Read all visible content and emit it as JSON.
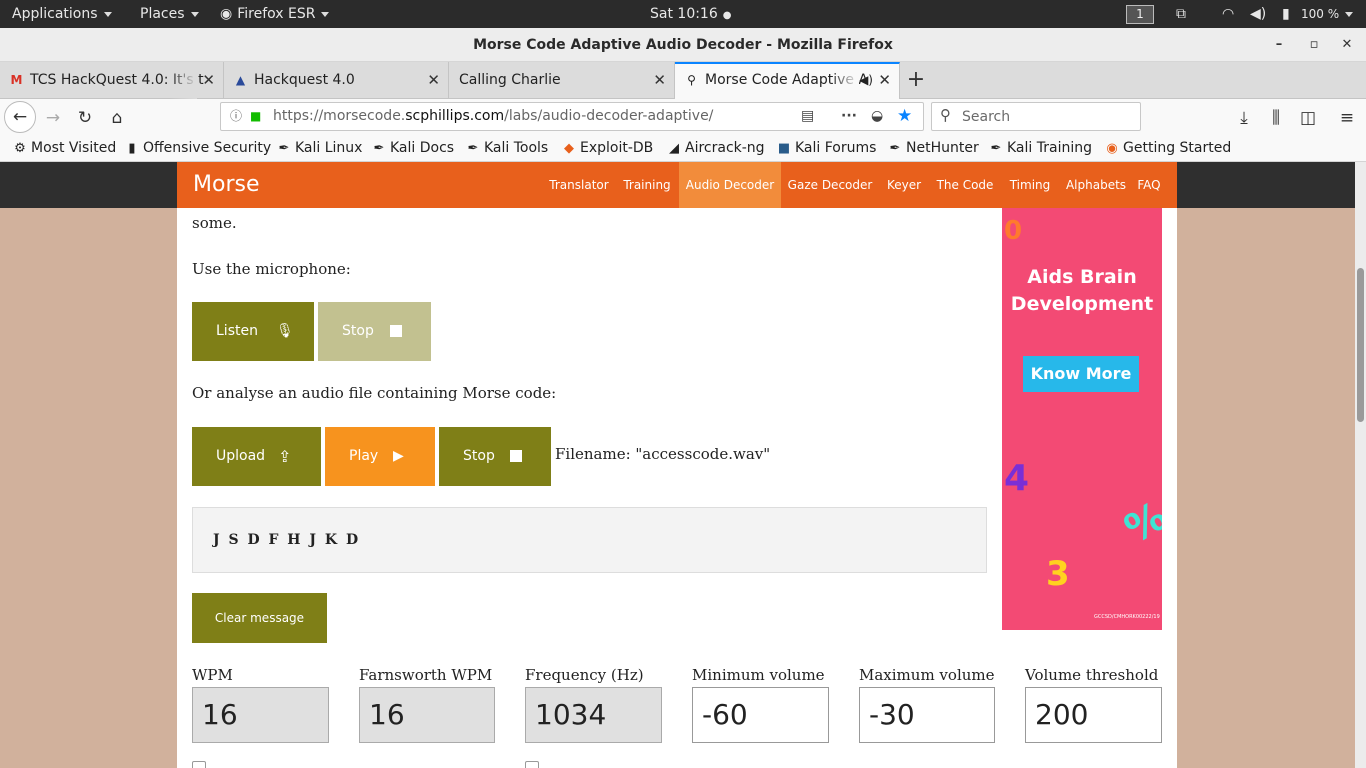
{
  "topbar": {
    "applications": "Applications",
    "places": "Places",
    "firefox": "Firefox ESR",
    "clock": "Sat 10:16",
    "workspace": "1",
    "battery": "100 %"
  },
  "window": {
    "title": "Morse Code Adaptive Audio Decoder - Mozilla Firefox"
  },
  "tabs": [
    {
      "label": "TCS HackQuest 4.0: It's t",
      "icon": "gmail-icon"
    },
    {
      "label": "Hackquest 4.0",
      "icon": "tata-icon"
    },
    {
      "label": "Calling Charlie",
      "icon": ""
    },
    {
      "label": "Morse Code Adaptive A",
      "icon": "morse-icon",
      "active": true
    }
  ],
  "navbar": {
    "url_prefix": "https://morsecode.",
    "url_domain": "scphillips.com",
    "url_path": "/labs/audio-decoder-adaptive/",
    "search_placeholder": "Search"
  },
  "bookmarks": [
    "Most Visited",
    "Offensive Security",
    "Kali Linux",
    "Kali Docs",
    "Kali Tools",
    "Exploit-DB",
    "Aircrack-ng",
    "Kali Forums",
    "NetHunter",
    "Kali Training",
    "Getting Started"
  ],
  "site": {
    "brand": "Morse",
    "nav": [
      "Translator",
      "Training",
      "Audio Decoder",
      "Gaze Decoder",
      "Keyer",
      "The Code",
      "Timing",
      "Alphabets",
      "FAQ"
    ],
    "active_nav": "Audio Decoder"
  },
  "content": {
    "intro_tail": "some.",
    "mic_label": "Use the microphone:",
    "listen_label": "Listen",
    "stop_label": "Stop",
    "file_label": "Or analyse an audio file containing Morse code:",
    "upload_label": "Upload",
    "play_label": "Play",
    "stop2_label": "Stop",
    "filename": "Filename: \"accesscode.wav\"",
    "message": "J S D F H J K D",
    "clear_label": "Clear message"
  },
  "fields": [
    {
      "label": "WPM",
      "value": "16",
      "readonly": true
    },
    {
      "label": "Farnsworth WPM",
      "value": "16",
      "readonly": true
    },
    {
      "label": "Frequency (Hz)",
      "value": "1034",
      "readonly": true
    },
    {
      "label": "Minimum volume",
      "value": "-60",
      "readonly": false
    },
    {
      "label": "Maximum volume",
      "value": "-30",
      "readonly": false
    },
    {
      "label": "Volume threshold",
      "value": "200",
      "readonly": false
    }
  ],
  "ad": {
    "headline": "Aids Brain Development",
    "cta": "Know More",
    "fine": "GCCSD/CMHORK00222/19"
  },
  "colors": {
    "brand_orange": "#e8601c",
    "olive": "#7f7f17",
    "play_orange": "#f7931e",
    "ad_pink": "#f34a74"
  }
}
